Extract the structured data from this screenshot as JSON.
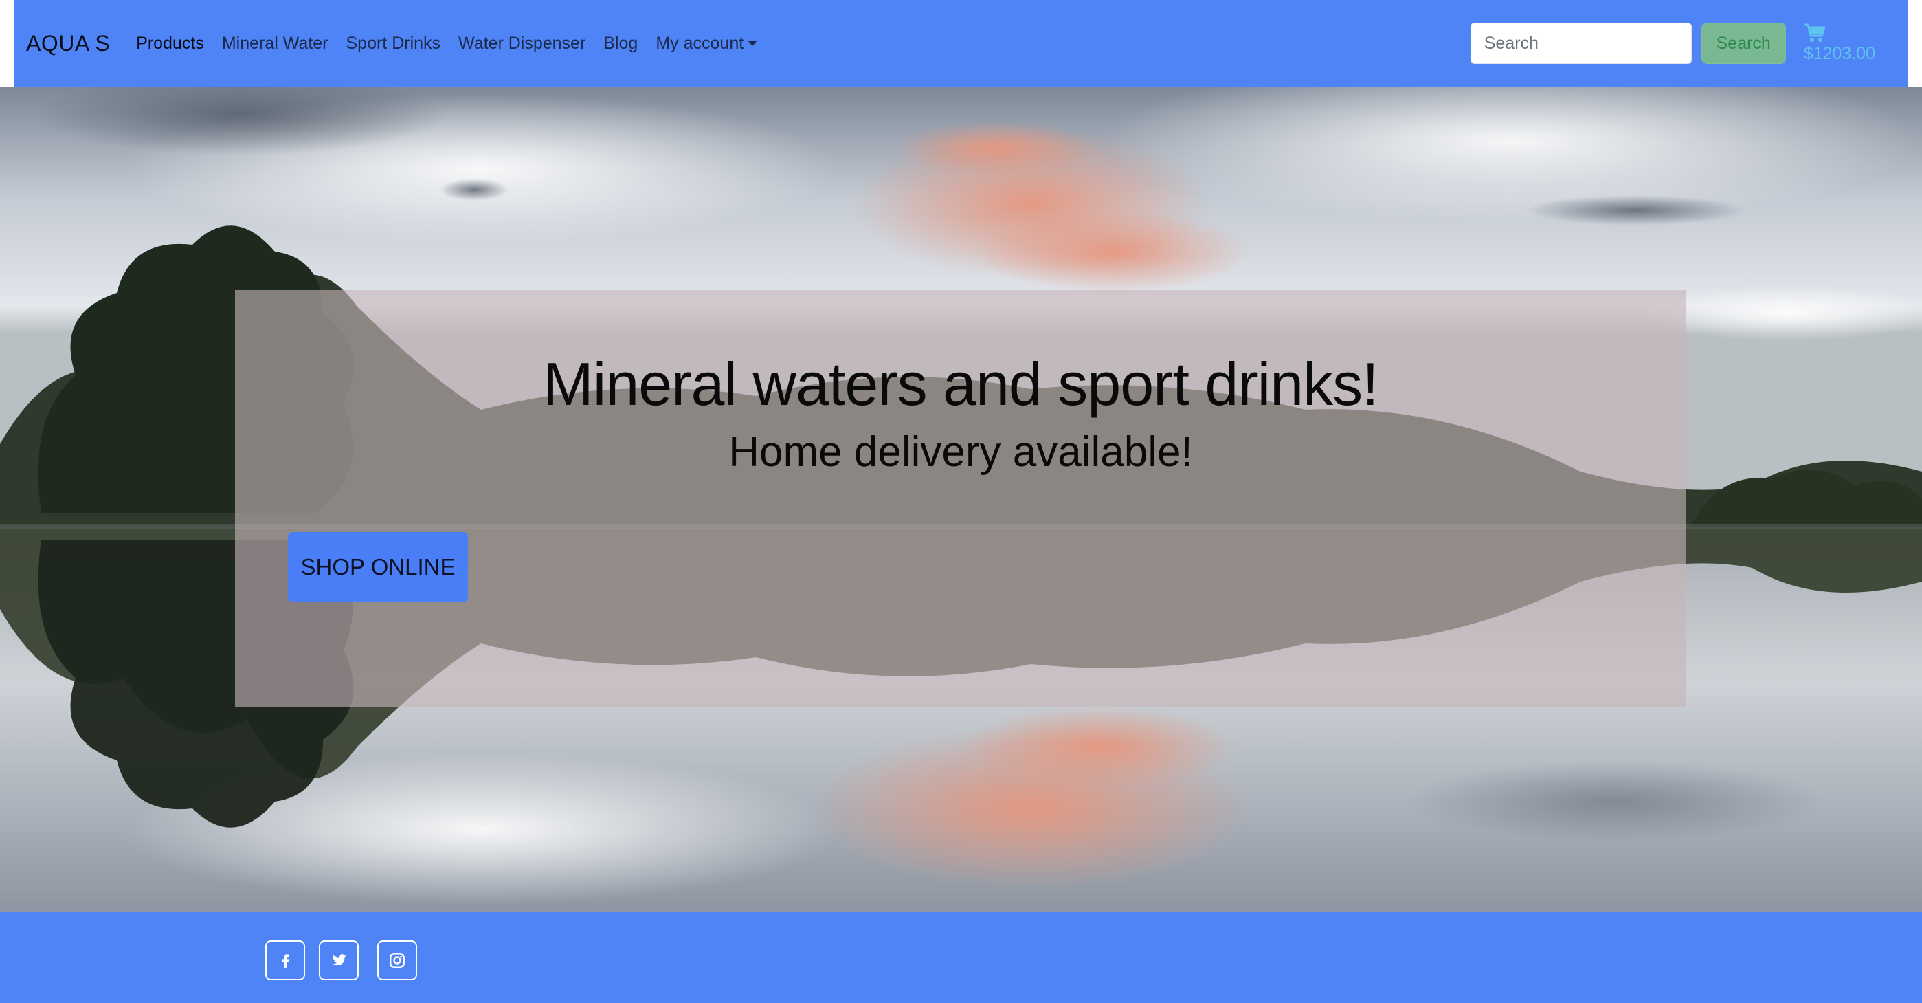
{
  "navbar": {
    "brand": "AQUA S",
    "links": [
      {
        "label": "Products"
      },
      {
        "label": "Mineral Water"
      },
      {
        "label": "Sport Drinks"
      },
      {
        "label": "Water Dispenser"
      },
      {
        "label": "Blog"
      },
      {
        "label": "My account"
      }
    ],
    "search": {
      "placeholder": "Search",
      "button_label": "Search"
    },
    "cart": {
      "icon": "cart-icon",
      "total": "$1203.00"
    }
  },
  "hero": {
    "title": "Mineral waters and sport drinks!",
    "subtitle": "Home delivery available!",
    "cta_label": "SHOP ONLINE",
    "background": "lake-reflection-sunset-photo"
  },
  "footer": {
    "social": [
      {
        "icon": "facebook-icon"
      },
      {
        "icon": "twitter-icon"
      },
      {
        "icon": "instagram-icon"
      }
    ]
  },
  "colors": {
    "primary": "#4f84f7",
    "button": "#4a7ef6",
    "success": "#79b893",
    "cart_text": "#5ec3ee"
  }
}
